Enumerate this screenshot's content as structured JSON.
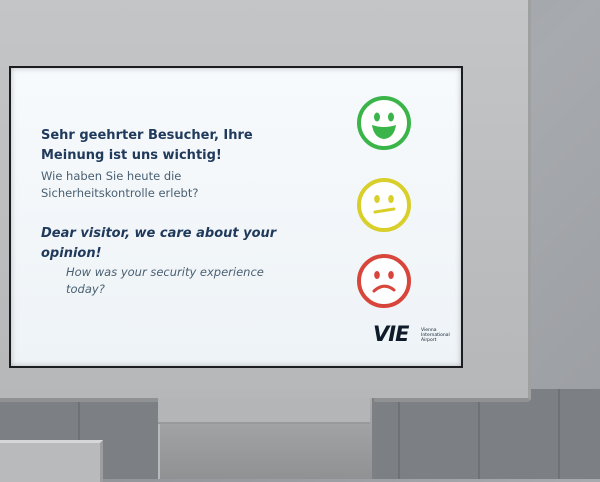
{
  "prompt": {
    "de_heading": "Sehr geehrter Besucher, Ihre Meinung ist uns wichtig!",
    "de_question": "Wie haben Sie heute die Sicherheitskontrolle erlebt?",
    "en_heading": "Dear visitor, we care about your opinion!",
    "en_question": "How was your security experience today?"
  },
  "ratings": [
    {
      "name": "happy",
      "color": "#3bb54a"
    },
    {
      "name": "neutral",
      "color": "#d8cf2a"
    },
    {
      "name": "sad",
      "color": "#d8453a"
    }
  ],
  "logo": {
    "mark": "VIE",
    "text": "Vienna International Airport"
  }
}
